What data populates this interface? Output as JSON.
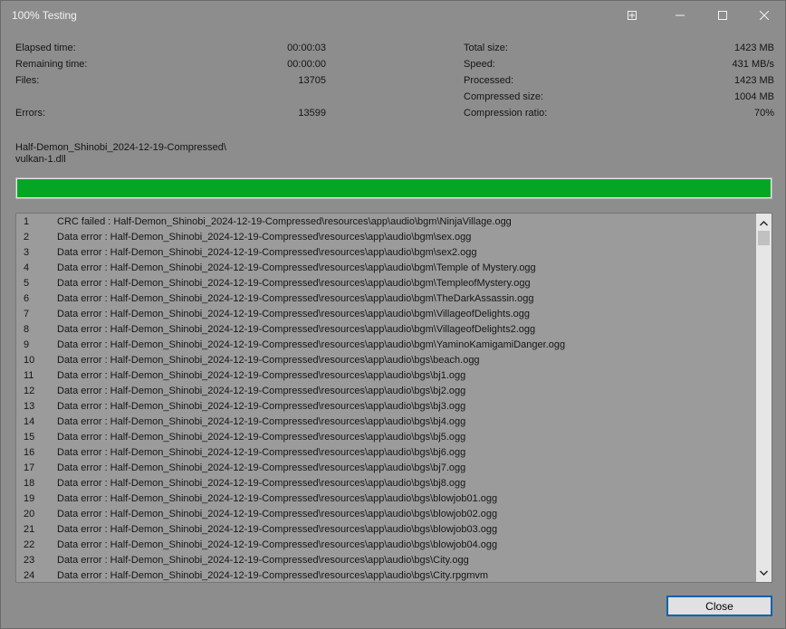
{
  "window": {
    "title": "100% Testing",
    "controls": [
      "pin-icon",
      "minimize-icon",
      "maximize-icon",
      "close-icon"
    ]
  },
  "stats_left": [
    {
      "label": "Elapsed time:",
      "value": "00:00:03"
    },
    {
      "label": "Remaining time:",
      "value": "00:00:00"
    },
    {
      "label": "Files:",
      "value": "13705"
    },
    {
      "label": "Errors:",
      "value": "13599"
    }
  ],
  "stats_right": [
    {
      "label": "Total size:",
      "value": "1423 MB"
    },
    {
      "label": "Speed:",
      "value": "431 MB/s"
    },
    {
      "label": "Processed:",
      "value": "1423 MB"
    },
    {
      "label": "Compressed size:",
      "value": "1004 MB"
    },
    {
      "label": "Compression ratio:",
      "value": "70%"
    }
  ],
  "current_path": {
    "folder": "Half-Demon_Shinobi_2024-12-19-Compressed\\",
    "file": "vulkan-1.dll"
  },
  "progress": {
    "percent": 100,
    "color": "#06a625"
  },
  "log": [
    {
      "n": "1",
      "msg": "CRC failed : Half-Demon_Shinobi_2024-12-19-Compressed\\resources\\app\\audio\\bgm\\NinjaVillage.ogg"
    },
    {
      "n": "2",
      "msg": "Data error : Half-Demon_Shinobi_2024-12-19-Compressed\\resources\\app\\audio\\bgm\\sex.ogg"
    },
    {
      "n": "3",
      "msg": "Data error : Half-Demon_Shinobi_2024-12-19-Compressed\\resources\\app\\audio\\bgm\\sex2.ogg"
    },
    {
      "n": "4",
      "msg": "Data error : Half-Demon_Shinobi_2024-12-19-Compressed\\resources\\app\\audio\\bgm\\Temple of Mystery.ogg"
    },
    {
      "n": "5",
      "msg": "Data error : Half-Demon_Shinobi_2024-12-19-Compressed\\resources\\app\\audio\\bgm\\TempleofMystery.ogg"
    },
    {
      "n": "6",
      "msg": "Data error : Half-Demon_Shinobi_2024-12-19-Compressed\\resources\\app\\audio\\bgm\\TheDarkAssassin.ogg"
    },
    {
      "n": "7",
      "msg": "Data error : Half-Demon_Shinobi_2024-12-19-Compressed\\resources\\app\\audio\\bgm\\VillageofDelights.ogg"
    },
    {
      "n": "8",
      "msg": "Data error : Half-Demon_Shinobi_2024-12-19-Compressed\\resources\\app\\audio\\bgm\\VillageofDelights2.ogg"
    },
    {
      "n": "9",
      "msg": "Data error : Half-Demon_Shinobi_2024-12-19-Compressed\\resources\\app\\audio\\bgm\\YaminoKamigamiDanger.ogg"
    },
    {
      "n": "10",
      "msg": "Data error : Half-Demon_Shinobi_2024-12-19-Compressed\\resources\\app\\audio\\bgs\\beach.ogg"
    },
    {
      "n": "11",
      "msg": "Data error : Half-Demon_Shinobi_2024-12-19-Compressed\\resources\\app\\audio\\bgs\\bj1.ogg"
    },
    {
      "n": "12",
      "msg": "Data error : Half-Demon_Shinobi_2024-12-19-Compressed\\resources\\app\\audio\\bgs\\bj2.ogg"
    },
    {
      "n": "13",
      "msg": "Data error : Half-Demon_Shinobi_2024-12-19-Compressed\\resources\\app\\audio\\bgs\\bj3.ogg"
    },
    {
      "n": "14",
      "msg": "Data error : Half-Demon_Shinobi_2024-12-19-Compressed\\resources\\app\\audio\\bgs\\bj4.ogg"
    },
    {
      "n": "15",
      "msg": "Data error : Half-Demon_Shinobi_2024-12-19-Compressed\\resources\\app\\audio\\bgs\\bj5.ogg"
    },
    {
      "n": "16",
      "msg": "Data error : Half-Demon_Shinobi_2024-12-19-Compressed\\resources\\app\\audio\\bgs\\bj6.ogg"
    },
    {
      "n": "17",
      "msg": "Data error : Half-Demon_Shinobi_2024-12-19-Compressed\\resources\\app\\audio\\bgs\\bj7.ogg"
    },
    {
      "n": "18",
      "msg": "Data error : Half-Demon_Shinobi_2024-12-19-Compressed\\resources\\app\\audio\\bgs\\bj8.ogg"
    },
    {
      "n": "19",
      "msg": "Data error : Half-Demon_Shinobi_2024-12-19-Compressed\\resources\\app\\audio\\bgs\\blowjob01.ogg"
    },
    {
      "n": "20",
      "msg": "Data error : Half-Demon_Shinobi_2024-12-19-Compressed\\resources\\app\\audio\\bgs\\blowjob02.ogg"
    },
    {
      "n": "21",
      "msg": "Data error : Half-Demon_Shinobi_2024-12-19-Compressed\\resources\\app\\audio\\bgs\\blowjob03.ogg"
    },
    {
      "n": "22",
      "msg": "Data error : Half-Demon_Shinobi_2024-12-19-Compressed\\resources\\app\\audio\\bgs\\blowjob04.ogg"
    },
    {
      "n": "23",
      "msg": "Data error : Half-Demon_Shinobi_2024-12-19-Compressed\\resources\\app\\audio\\bgs\\City.ogg"
    },
    {
      "n": "24",
      "msg": "Data error : Half-Demon_Shinobi_2024-12-19-Compressed\\resources\\app\\audio\\bgs\\City.rpgmvm"
    }
  ],
  "buttons": {
    "close_label": "Close"
  }
}
